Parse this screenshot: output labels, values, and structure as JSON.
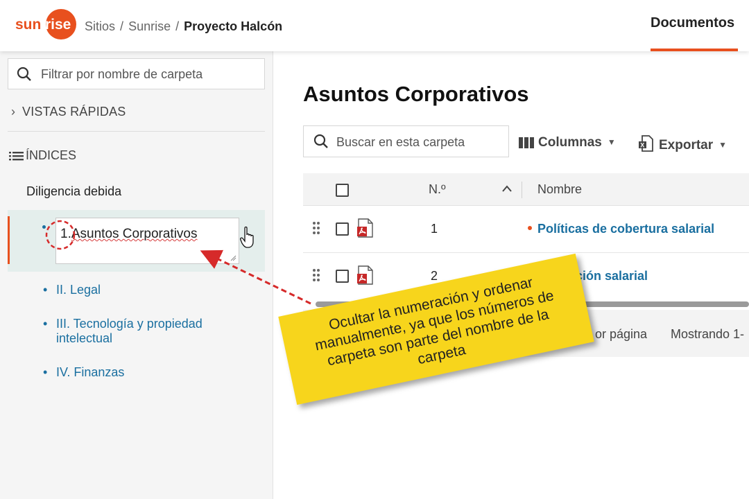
{
  "header": {
    "logo_text": "sunrise",
    "breadcrumb": [
      "Sitios",
      "Sunrise",
      "Proyecto Halcón"
    ],
    "breadcrumb_sep": "/",
    "active_tab": "Documentos"
  },
  "sidebar": {
    "filter_placeholder": "Filtrar por nombre de carpeta",
    "quick_views": "VISTAS RÁPIDAS",
    "indices": "ÍNDICES",
    "group": "Diligencia debida",
    "editing": {
      "prefix": "1.",
      "value": "Asuntos Corporativos"
    },
    "items": [
      {
        "label": "II. Legal"
      },
      {
        "label": "III. Tecnología y propiedad intelectual"
      },
      {
        "label": "IV. Finanzas"
      }
    ]
  },
  "main": {
    "title": "Asuntos Corporativos",
    "search_placeholder": "Buscar en esta carpeta",
    "columns_label": "Columnas",
    "export_label": "Exportar",
    "table": {
      "col_number": "N.º",
      "col_name": "Nombre",
      "rows": [
        {
          "number": "1",
          "name": "Políticas de cobertura salarial",
          "unread": true
        },
        {
          "number": "2",
          "name": "ción salarial",
          "unread": false
        }
      ]
    },
    "pager": {
      "per_page": "or página",
      "showing": "Mostrando 1-"
    }
  },
  "annotation": {
    "text": "Ocultar la numeración y ordenar manualmente, ya que los números de carpeta son parte del nombre de la carpeta"
  },
  "colors": {
    "accent": "#e8501e",
    "link": "#1a6fa0",
    "note": "#f7d51c",
    "arrow": "#d62a2a"
  }
}
